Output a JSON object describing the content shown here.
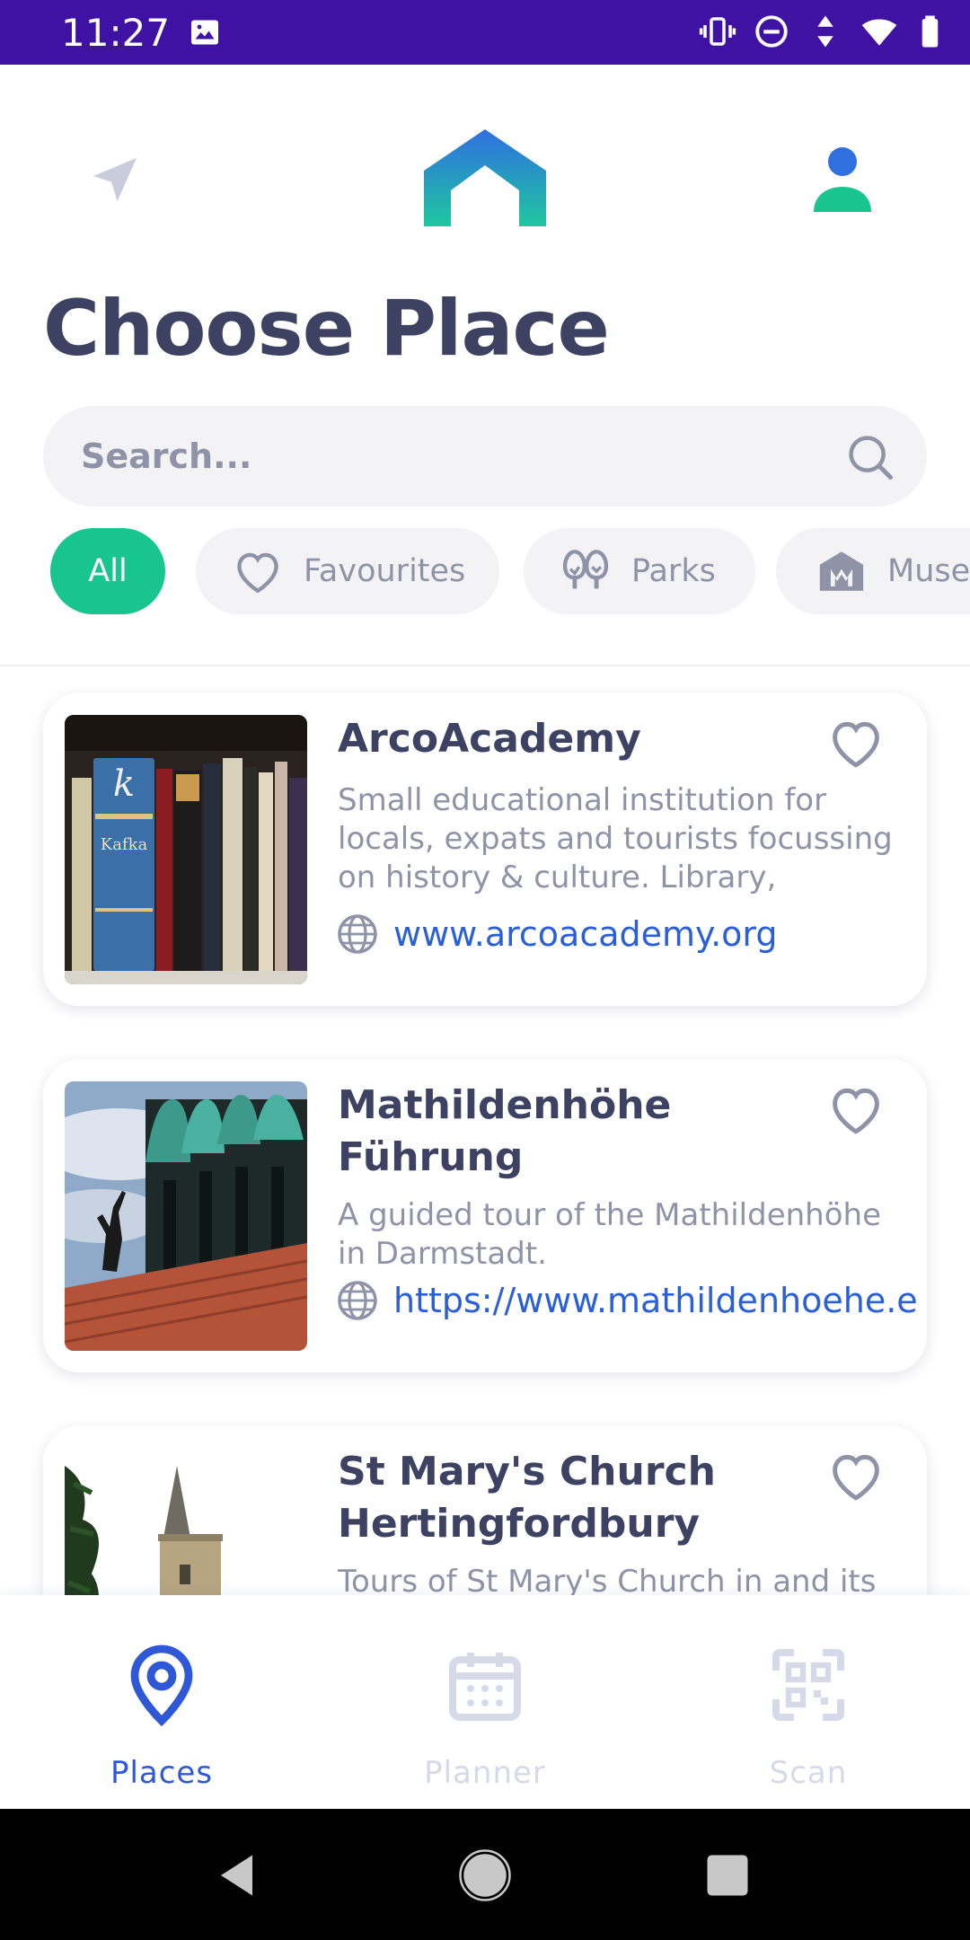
{
  "status_bar": {
    "time": "11:27",
    "bg_color": "#3f12a4"
  },
  "header": {
    "left_icon": "navigation-arrow-icon",
    "logo": "app-logo",
    "right_icon": "user-profile-icon"
  },
  "page": {
    "title": "Choose Place"
  },
  "search": {
    "placeholder": "Search...",
    "value": ""
  },
  "filters": {
    "items": [
      {
        "label": "All",
        "icon": "",
        "selected": true
      },
      {
        "label": "Favourites",
        "icon": "heart-icon",
        "selected": false
      },
      {
        "label": "Parks",
        "icon": "trees-icon",
        "selected": false
      },
      {
        "label": "Muse",
        "icon": "museum-icon",
        "selected": false
      }
    ],
    "accent_color": "#19c58f"
  },
  "places": [
    {
      "title": "ArcoAcademy",
      "description": "Small educational institution for locals, expats and tourists focussing on history & culture. Library, media…",
      "link": "www.arcoacademy.org",
      "image": "bookshelf-photo"
    },
    {
      "title": "Mathildenhöhe Führung",
      "description": "A guided tour of the Mathildenhöhe in Darmstadt.",
      "link": "https://www.mathildenhoehe.e",
      "image": "wedding-tower-photo"
    },
    {
      "title": "St Mary's Church Hertingfordbury",
      "description": "Tours of St Mary's Church in and its",
      "link": "",
      "image": "church-tower-photo"
    }
  ],
  "bottom_nav": {
    "tabs": [
      {
        "label": "Places",
        "icon": "map-pin-icon",
        "active": true
      },
      {
        "label": "Planner",
        "icon": "calendar-icon",
        "active": false
      },
      {
        "label": "Scan",
        "icon": "qr-code-icon",
        "active": false
      }
    ],
    "active_color": "#2f58d6",
    "inactive_color": "#d6d9e8"
  }
}
